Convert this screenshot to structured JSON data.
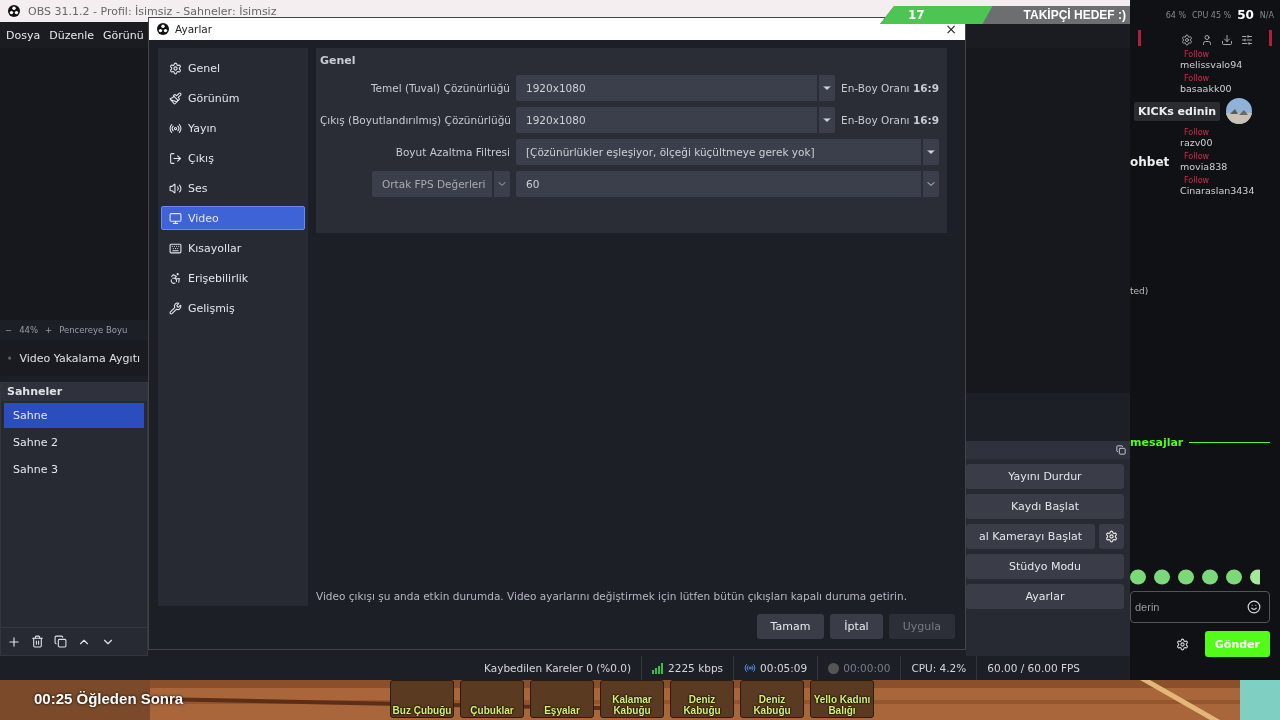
{
  "obs_window": {
    "title": "OBS 31.1.2 - Profil: İsimsiz - Sahneler: İsimsiz",
    "menu": [
      "Dosya",
      "Düzenle",
      "Görünü"
    ],
    "zoom_bar": {
      "minus": "−",
      "zoom": "44%",
      "plus": "+",
      "fit": "Pencereye Boyu"
    },
    "source": "Video Yakalama Aygıtı",
    "scenes": {
      "title": "Sahneler",
      "items": [
        {
          "label": "Sahne",
          "selected": true
        },
        {
          "label": "Sahne 2",
          "selected": false
        },
        {
          "label": "Sahne 3",
          "selected": false
        }
      ]
    },
    "controls": [
      {
        "label": "Yayını Durdur",
        "kind": "plain"
      },
      {
        "label": "Kaydı Başlat",
        "kind": "plain"
      },
      {
        "label": "al Kamerayı Başlat",
        "kind": "gear"
      },
      {
        "label": "Stüdyo Modu",
        "kind": "plain"
      },
      {
        "label": "Ayarlar",
        "kind": "plain"
      }
    ],
    "status_bar": {
      "dropped": "Kaybedilen Kareler 0 (%0.0)",
      "bitrate": "2225 kbps",
      "stream_time": "00:05:09",
      "record_time": "00:00:00",
      "cpu": "CPU: 4.2%",
      "fps": "60.00 / 60.00 FPS"
    }
  },
  "settings_dialog": {
    "title": "Ayarlar",
    "close": "×",
    "sidebar": [
      {
        "label": "Genel",
        "selected": false
      },
      {
        "label": "Görünüm",
        "selected": false
      },
      {
        "label": "Yayın",
        "selected": false
      },
      {
        "label": "Çıkış",
        "selected": false
      },
      {
        "label": "Ses",
        "selected": false
      },
      {
        "label": "Video",
        "selected": true
      },
      {
        "label": "Kısayollar",
        "selected": false
      },
      {
        "label": "Erişebilirlik",
        "selected": false
      },
      {
        "label": "Gelişmiş",
        "selected": false
      }
    ],
    "group": "Genel",
    "rows": [
      {
        "kind": "labeled",
        "label": "Temel (Tuval) Çözünürlüğü",
        "value": "1920x1080",
        "note": "En-Boy Oranı **16:9**"
      },
      {
        "kind": "labeled",
        "label": "Çıkış (Boyutlandırılmış) Çözünürlüğü",
        "value": "1920x1080",
        "note": "En-Boy Oranı **16:9**"
      },
      {
        "kind": "labeled",
        "label": "Boyut Azaltma Filtresi",
        "value": "[Çözünürlükler eşleşiyor, ölçeği küçültmeye gerek yok]"
      },
      {
        "kind": "fps",
        "label": "Ortak FPS Değerleri",
        "value": "60"
      }
    ],
    "warning": "Video çıkışı şu anda etkin durumda. Video ayarlarını değiştirmek için lütfen bütün çıkışları kapalı duruma getirin.",
    "buttons": [
      {
        "label": "Tamam",
        "disabled": false
      },
      {
        "label": "İptal",
        "disabled": false
      },
      {
        "label": "Uygula",
        "disabled": true
      }
    ]
  },
  "follower_goal": {
    "count": "17",
    "label": "TAKİPÇİ HEDEF :)",
    "level": 0.45
  },
  "chat": {
    "stats": [
      "64 %",
      "CPU 45 %",
      "50",
      "N/A"
    ],
    "follows": [
      {
        "tag": "Follow",
        "name": "melissvalo94"
      },
      {
        "tag": "Follow",
        "name": "basaakk00"
      },
      {
        "tag": "Follow",
        "name": "razv00"
      },
      {
        "tag": "Follow",
        "name": "movia838"
      },
      {
        "tag": "Follow",
        "name": "Cinaraslan3434"
      }
    ],
    "promo": "KICKs edinin",
    "heading": "ohbet",
    "note": "ted)",
    "divider": "mesajlar",
    "input": {
      "placeholder": "derin"
    },
    "send": "Gönder"
  },
  "game": {
    "clock": "00:25 Öğleden Sonra",
    "slots": [
      "Buz Çubuğu",
      "Çubuklar",
      "Eşyalar",
      "Kalamar Kabuğu",
      "Deniz Kabuğu",
      "Deniz Kabuğu",
      "Yello Kadını Balığı"
    ]
  }
}
